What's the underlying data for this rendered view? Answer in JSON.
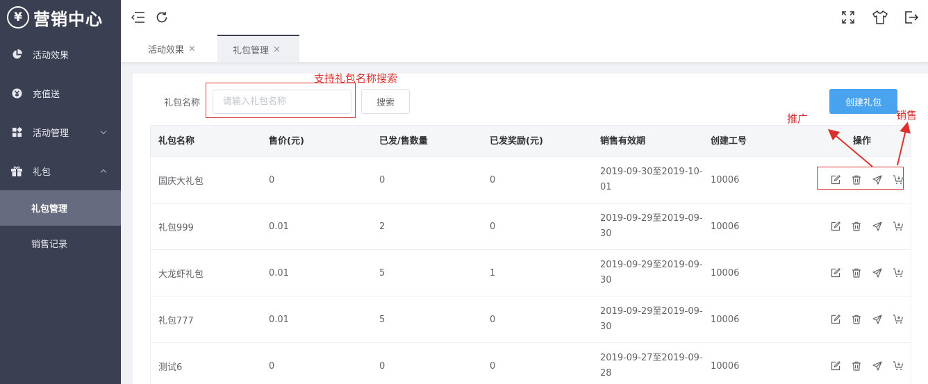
{
  "logo": {
    "symbol": "¥",
    "text": "营销中心"
  },
  "sidebar": {
    "items": [
      {
        "label": "活动效果",
        "icon": "pie-chart-icon"
      },
      {
        "label": "充值送",
        "icon": "yen-coin-icon"
      },
      {
        "label": "活动管理",
        "icon": "grid-icon",
        "arrow": "chevron-down-icon"
      },
      {
        "label": "礼包",
        "icon": "gift-icon",
        "arrow": "chevron-up-icon"
      }
    ],
    "subitems": [
      {
        "label": "礼包管理",
        "active": true
      },
      {
        "label": "销售记录",
        "active": false
      }
    ]
  },
  "header": {
    "left_icons": [
      "menu-fold-icon",
      "refresh-icon"
    ],
    "right_icons": [
      "fullscreen-icon",
      "shirt-theme-icon",
      "logout-icon"
    ]
  },
  "tabs": [
    {
      "label": "活动效果",
      "close": "×",
      "active": false
    },
    {
      "label": "礼包管理",
      "close": "×",
      "active": true
    }
  ],
  "filter": {
    "label": "礼包名称",
    "placeholder": "请输入礼包名称",
    "search_label": "搜索",
    "create_label": "创建礼包"
  },
  "annotations": {
    "search_hint": "支持礼包名称搜索",
    "promote": "推广",
    "sell": "销售"
  },
  "table": {
    "headers": [
      "礼包名称",
      "售价(元)",
      "已发/售数量",
      "已发奖励(元)",
      "销售有效期",
      "创建工号",
      "操作"
    ],
    "rows": [
      [
        "国庆大礼包",
        "0",
        "0",
        "0",
        "2019-09-30至2019-10-01",
        "10006"
      ],
      [
        "礼包999",
        "0.01",
        "2",
        "0",
        "2019-09-29至2019-09-30",
        "10006"
      ],
      [
        "大龙虾礼包",
        "0.01",
        "5",
        "1",
        "2019-09-29至2019-09-30",
        "10006"
      ],
      [
        "礼包777",
        "0.01",
        "5",
        "0",
        "2019-09-29至2019-09-30",
        "10006"
      ],
      [
        "测试6",
        "0",
        "0",
        "0",
        "2019-09-27至2019-09-28",
        "10006"
      ]
    ],
    "row_actions": [
      "edit-icon",
      "delete-icon",
      "promote-send-icon",
      "sell-cart-icon"
    ]
  },
  "colors": {
    "sidebar_bg": "#3a3f51",
    "sidebar_active": "#676b80",
    "primary": "#4aa3ef",
    "annotation": "#d9322e"
  }
}
